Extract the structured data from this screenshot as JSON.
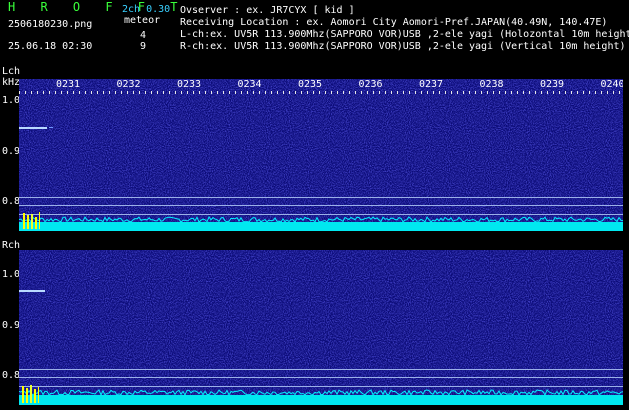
{
  "header": {
    "logo": "H R O F F T",
    "version": "2ch 0.30",
    "filename": "2506180230.png",
    "datetime": "25.06.18 02:30",
    "meteor_label": "meteor",
    "lch_count": "4",
    "rch_count": "9",
    "observer": "Ovserver              : ex. JR7CYX [ kid ]",
    "location": "Receiving Location : ex. Aomori City Aomori-Pref.JAPAN(40.49N, 140.47E)",
    "lch_info": "L-ch:ex. UV5R 113.900Mhz(SAPPORO VOR)USB ,2-ele yagi (Holozontal 10m height",
    "rch_info": "R-ch:ex. UV5R 113.900Mhz(SAPPORO VOR)USB ,2-ele yagi (Vertical 10m height)"
  },
  "lch": {
    "label": "Lch",
    "unit": "kHz",
    "y_ticks": [
      "1.0",
      "0.9",
      "0.8"
    ],
    "times": [
      "0231",
      "0232",
      "0233",
      "0234",
      "0235",
      "0236",
      "0237",
      "0238",
      "0239",
      "0240"
    ]
  },
  "rch": {
    "label": "Rch",
    "y_ticks": [
      "1.0",
      "0.9",
      "0.8"
    ]
  },
  "colors": {
    "background": "#000000",
    "spectrogram": "#14148c",
    "baseline": "#00ffff",
    "logo": "#39ff3a",
    "version": "#39d0ff",
    "signal_peak": "#ffff00"
  }
}
